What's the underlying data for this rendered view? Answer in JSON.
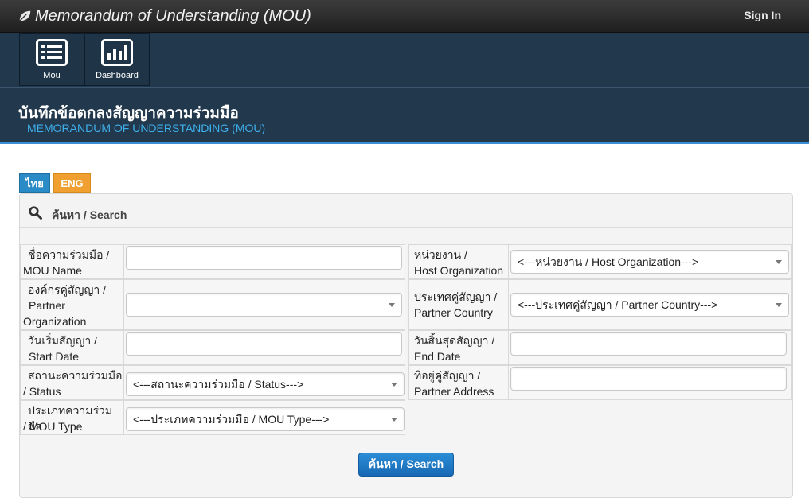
{
  "app": {
    "title": "Memorandum of Understanding (MOU)",
    "sign_in": "Sign In"
  },
  "nav": {
    "tiles": [
      {
        "label": "Mou",
        "icon": "list-icon"
      },
      {
        "label": "Dashboard",
        "icon": "bar-chart-icon"
      }
    ]
  },
  "header": {
    "title_thai": "บันทึกข้อตกลงสัญญาความร่วมมือ",
    "title_eng": "MEMORANDUM OF UNDERSTANDING (MOU)"
  },
  "language": {
    "thai": "ไทย",
    "eng": "ENG"
  },
  "search_panel": {
    "title": "ค้นหา / Search",
    "icon": "search-icon",
    "button": "ค้นหา / Search"
  },
  "form": {
    "mou_name": {
      "label_l1": "ชื่อความร่วมมือ /",
      "label_l2": "MOU Name",
      "value": ""
    },
    "host_org": {
      "label_l1": "หน่วยงาน /",
      "label_l2": "Host Organization",
      "value": "<---หน่วยงาน / Host Organization--->"
    },
    "partner_org": {
      "label_l1": "องค์กรคู่สัญญา /",
      "label_l2": "Partner",
      "label_l3": "Organization",
      "value": ""
    },
    "partner_country": {
      "label_l1": "ประเทศคู่สัญญา /",
      "label_l2": "Partner Country",
      "value": "<---ประเทศคู่สัญญา / Partner Country--->"
    },
    "start_date": {
      "label_l1": "วันเริ่มสัญญา /",
      "label_l2": "Start Date",
      "value": ""
    },
    "end_date": {
      "label_l1": "วันสิ้นสุดสัญญา /",
      "label_l2": "End Date",
      "value": ""
    },
    "status": {
      "label_l1": "สถานะความร่วมมือ",
      "label_l2": "/ Status",
      "value": "<---สถานะความร่วมมือ / Status--->"
    },
    "partner_address": {
      "label_l1": "ที่อยู่คู่สัญญา /",
      "label_l2": "Partner Address",
      "value": ""
    },
    "mou_type": {
      "label_l1": "ประเภทความร่วมมือ",
      "label_l2": "/ MOU Type",
      "value": "<---ประเภทความร่วมมือ / MOU Type--->"
    }
  },
  "colors": {
    "topbar": "#2b2b2b",
    "navband": "#22384c",
    "accent_blue": "#3b8fd6",
    "lang_thai": "#2a8bc7",
    "lang_eng": "#f0a030"
  }
}
